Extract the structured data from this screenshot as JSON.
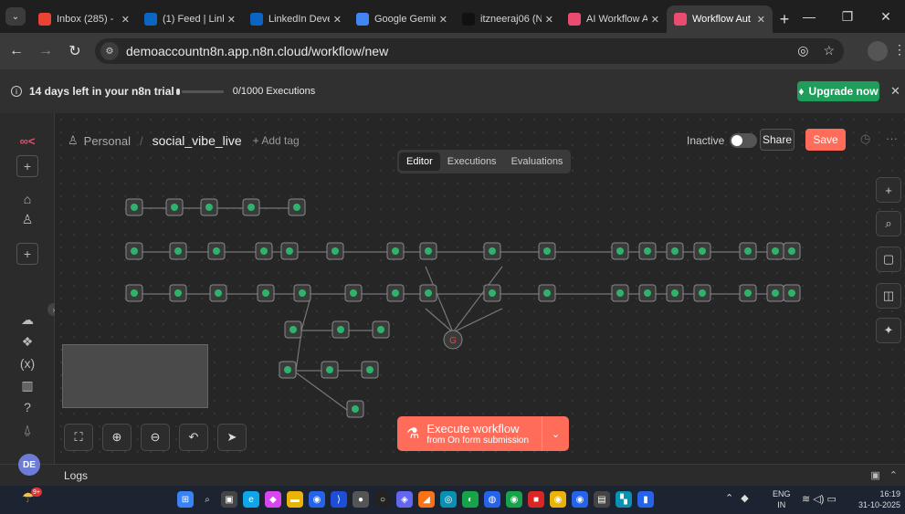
{
  "browser": {
    "tabs": [
      {
        "title": "Inbox (285) -",
        "favicon": "gmail-icon",
        "color": "#ea4335",
        "active": false
      },
      {
        "title": "(1) Feed | Link",
        "favicon": "linkedin-icon",
        "color": "#0a66c2",
        "active": false
      },
      {
        "title": "LinkedIn Deve",
        "favicon": "linkedin-icon",
        "color": "#0a66c2",
        "active": false
      },
      {
        "title": "Google Gemin",
        "favicon": "gemini-icon",
        "color": "#4285f4",
        "active": false
      },
      {
        "title": "itzneeraj06 (N",
        "favicon": "github-icon",
        "color": "#ffffff",
        "active": false
      },
      {
        "title": "AI Workflow A",
        "favicon": "n8n-icon",
        "color": "#ea4b71",
        "active": false
      },
      {
        "title": "Workflow Aut",
        "favicon": "n8n-icon",
        "color": "#ea4b71",
        "active": true
      }
    ],
    "url": "demoaccountn8n.app.n8n.cloud/workflow/new"
  },
  "trial_banner": {
    "days_left": "14 days left in your n8n trial",
    "executions": "0/1000 Executions",
    "executions_progress": 0,
    "upgrade_label": "Upgrade now"
  },
  "header": {
    "project": "Personal",
    "workflow_name": "social_vibe_live",
    "add_tag": "+ Add tag",
    "status": "Inactive",
    "share_label": "Share",
    "save_label": "Save"
  },
  "modes": {
    "editor": "Editor",
    "executions": "Executions",
    "evaluations": "Evaluations",
    "active": "editor"
  },
  "execute": {
    "title": "Execute workflow",
    "subtitle": "from On form submission"
  },
  "logs_label": "Logs",
  "user_initials": "DE",
  "colors": {
    "accent": "#ff6d5a",
    "upgrade": "#1e9e5a",
    "canvas": "#262626"
  },
  "taskbar": {
    "weather_badge": "9+",
    "lang": "ENG",
    "region": "IN",
    "time": "16:19",
    "date": "31-10-2025"
  }
}
